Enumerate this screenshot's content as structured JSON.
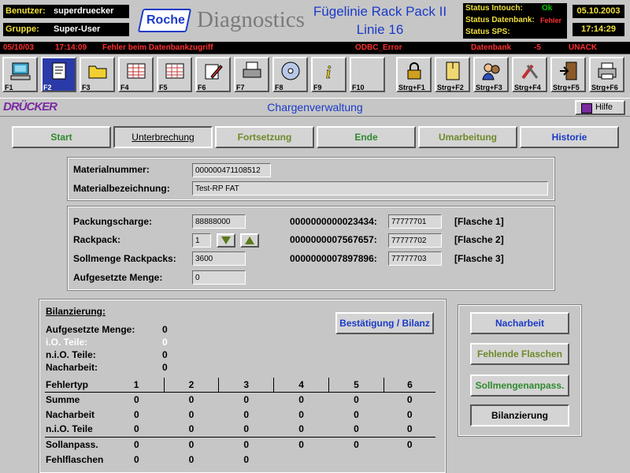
{
  "header": {
    "user_label": "Benutzer:",
    "user_value": "superdruecker",
    "group_label": "Gruppe:",
    "group_value": "Super-User",
    "logo_text": "Roche",
    "brand": "Diagnostics",
    "line_title": "Fügelinie Rack Pack II",
    "line_sub": "Linie 16",
    "status": [
      {
        "label": "Status Intouch:",
        "value": "Ok",
        "color": "#00d000"
      },
      {
        "label": "Status Datenbank:",
        "value": "Fehler",
        "color": "#ff3030"
      },
      {
        "label": "Status SPS:",
        "value": "",
        "color": "#ffffff"
      }
    ],
    "date": "05.10.2003",
    "time": "17:14:29"
  },
  "alarm": {
    "date": "05/10/03",
    "time": "17:14:09",
    "message": "Fehler beim Datenbankzugriff",
    "source": "ODBC_Error",
    "area": "Datenbank",
    "value": "-5",
    "state": "UNACK"
  },
  "fkeys": [
    {
      "key": "F1",
      "icon": "computer-icon"
    },
    {
      "key": "F2",
      "icon": "document-icon"
    },
    {
      "key": "F3",
      "icon": "folder-icon"
    },
    {
      "key": "F4",
      "icon": "table-icon"
    },
    {
      "key": "F5",
      "icon": "grid-icon"
    },
    {
      "key": "F6",
      "icon": "edit-icon"
    },
    {
      "key": "F7",
      "icon": "printer-doc-icon"
    },
    {
      "key": "F8",
      "icon": "cd-icon"
    },
    {
      "key": "F9",
      "icon": "info-icon"
    },
    {
      "key": "F10",
      "icon": "blank-icon"
    },
    {
      "key": "Strg+F1",
      "icon": "lock-icon"
    },
    {
      "key": "Strg+F2",
      "icon": "envelope-icon"
    },
    {
      "key": "Strg+F3",
      "icon": "users-icon"
    },
    {
      "key": "Strg+F4",
      "icon": "tools-icon"
    },
    {
      "key": "Strg+F5",
      "icon": "exit-door-icon"
    },
    {
      "key": "Strg+F6",
      "icon": "printer-icon"
    }
  ],
  "titlebar": {
    "logo": "DRÜCKER",
    "title": "Chargenverwaltung",
    "help": "Hilfe"
  },
  "tabs": [
    {
      "label": "Start",
      "color": "#2f8a2f"
    },
    {
      "label": "Unterbrechung",
      "color": "#000000"
    },
    {
      "label": "Fortsetzung",
      "color": "#6e8a2a"
    },
    {
      "label": "Ende",
      "color": "#2f8a2f"
    },
    {
      "label": "Umarbeitung",
      "color": "#6e8a2a"
    },
    {
      "label": "Historie",
      "color": "#1a3ac8"
    }
  ],
  "material": {
    "number_label": "Materialnummer:",
    "number_value": "000000471108512",
    "desc_label": "Materialbezeichnung:",
    "desc_value": "Test-RP FAT"
  },
  "packing": {
    "charge_label": "Packungscharge:",
    "charge_value": "88888000",
    "rackpack_label": "Rackpack:",
    "rackpack_value": "1",
    "soll_label": "Sollmenge Rackpacks:",
    "soll_value": "3600",
    "aufg_label": "Aufgesetzte Menge:",
    "aufg_value": "0",
    "bottles": [
      {
        "code": "0000000000023434:",
        "value": "77777701",
        "name": "[Flasche 1]"
      },
      {
        "code": "0000000007567657:",
        "value": "77777702",
        "name": "[Flasche 2]"
      },
      {
        "code": "0000000007897896:",
        "value": "77777703",
        "name": "[Flasche 3]"
      }
    ]
  },
  "bilanz": {
    "title": "Bilanzierung:",
    "confirm_button": "Bestätigung / Bilanz",
    "summary": [
      {
        "label": "Aufgesetzte Menge:",
        "value": "0",
        "color": "#000000"
      },
      {
        "label": "i.O. Teile:",
        "value": "0",
        "color": "#ffffff"
      },
      {
        "label": "n.i.O. Teile:",
        "value": "0",
        "color": "#000000"
      },
      {
        "label": "Nacharbeit:",
        "value": "0",
        "color": "#000000"
      }
    ],
    "table_header": [
      "Fehlertyp",
      "1",
      "2",
      "3",
      "4",
      "5",
      "6"
    ],
    "rows": [
      [
        "Summe",
        "0",
        "0",
        "0",
        "0",
        "0",
        "0"
      ],
      [
        "Nacharbeit",
        "0",
        "0",
        "0",
        "0",
        "0",
        "0"
      ],
      [
        "n.i.O. Teile",
        "0",
        "0",
        "0",
        "0",
        "0",
        "0"
      ],
      [
        "Sollanpass.",
        "0",
        "0",
        "0",
        "0",
        "0",
        "0"
      ],
      [
        "Fehlflaschen",
        "0",
        "0",
        "0",
        "",
        "",
        ""
      ]
    ]
  },
  "side_buttons": [
    {
      "label": "Nacharbeit",
      "color": "#1a3ac8"
    },
    {
      "label": "Fehlende Flaschen",
      "color": "#6e8a2a"
    },
    {
      "label": "Sollmengenanpass.",
      "color": "#2f8a2f"
    },
    {
      "label": "Bilanzierung",
      "color": "#000000"
    }
  ]
}
